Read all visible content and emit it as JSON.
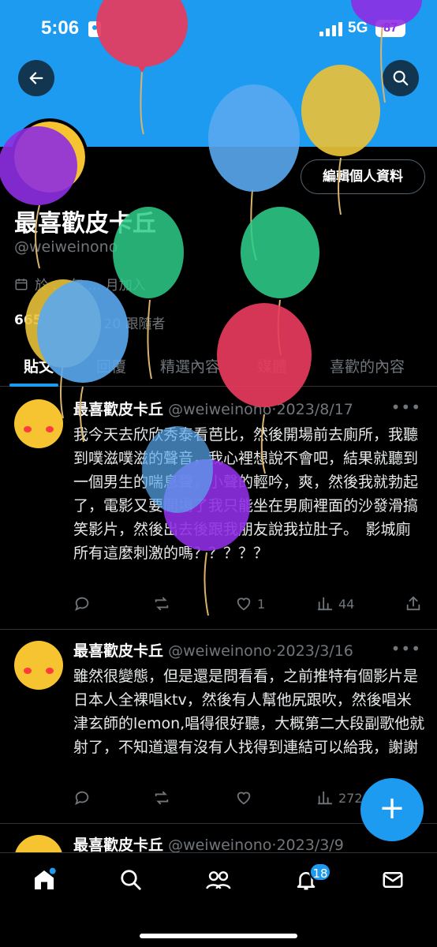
{
  "status_bar": {
    "time": "5:06",
    "network": "5G",
    "battery": "87"
  },
  "header": {
    "back_icon": "back-arrow-icon",
    "search_icon": "search-icon"
  },
  "profile": {
    "edit_label": "編輯個人資料",
    "display_name": "最喜歡皮卡丘",
    "handle": "@weiweinono",
    "joined": "於 … 年 … 月加入",
    "following_count": "665",
    "followers_label": "20 跟隨者"
  },
  "tabs": [
    "貼文",
    "回覆",
    "精選內容",
    "媒體",
    "喜歡的內容"
  ],
  "posts": [
    {
      "name": "最喜歡皮卡丘",
      "handle": "@weiweinono",
      "date": "·2023/8/17",
      "text": "我今天去欣欣秀泰看芭比，然後開場前去廁所，我聽到噗滋噗滋的聲音，我心裡想說不會吧，結果就聽到一個男生的喘息聲，小聲的輕吟，爽，然後我就勃起了，電影又要開場了我只能坐在男廁裡面的沙發滑搞笑影片，然後出去後跟我朋友說我拉肚子。　影城廁所有這麼刺激的嗎？？？？？",
      "replies": "",
      "reposts": "",
      "likes": "1",
      "views": "44"
    },
    {
      "name": "最喜歡皮卡丘",
      "handle": "@weiweinono",
      "date": "·2023/3/16",
      "text": "雖然很變態，但是還是問看看，之前推特有個影片是日本人全裸唱ktv，然後有人幫他尻跟吹，然後唱米津玄師的lemon,唱得很好聽，大概第二大段副歌他就射了，不知道還有沒有人找得到連結可以給我，謝謝",
      "replies": "",
      "reposts": "",
      "likes": "",
      "views": "272"
    },
    {
      "name": "最喜歡皮卡丘",
      "handle": "@weiweinono",
      "date": "·2023/3/9"
    }
  ],
  "fab_label": "+",
  "nav": {
    "notifications_badge": "18"
  },
  "colors": {
    "accent": "#1d9bf0",
    "background": "#000000",
    "muted": "#71767b"
  }
}
